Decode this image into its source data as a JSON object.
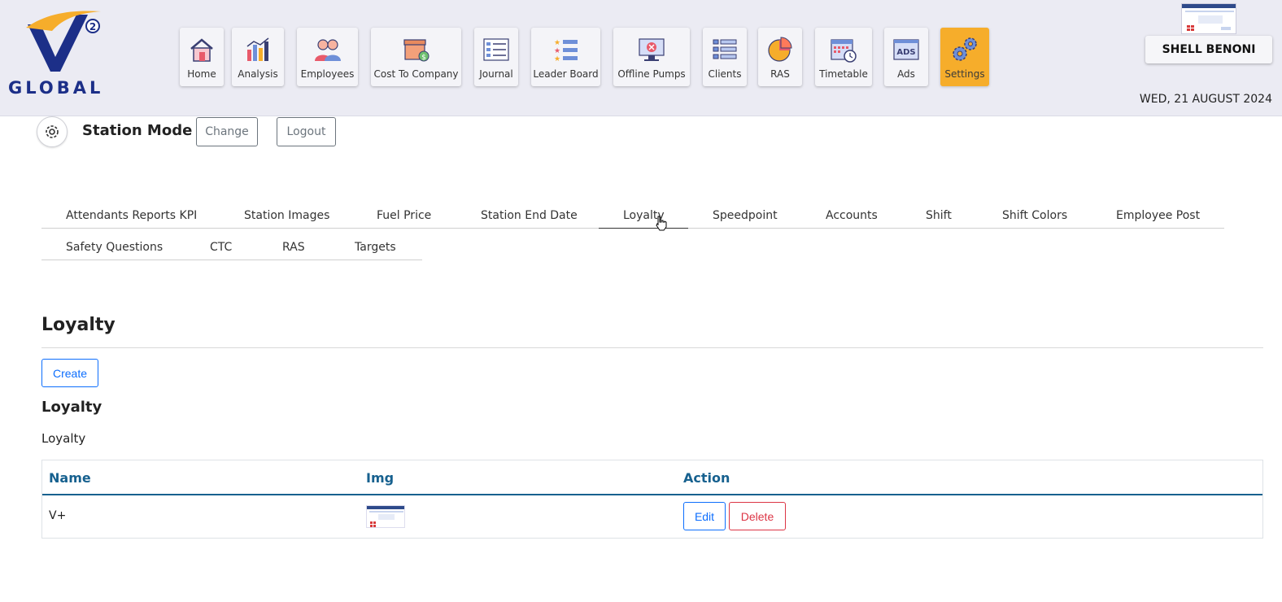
{
  "brand": {
    "logo_text": "GLOBAL",
    "logo_superscript": "2"
  },
  "nav": {
    "items": [
      {
        "label": "Home",
        "icon": "home-icon"
      },
      {
        "label": "Analysis",
        "icon": "bar-chart-icon"
      },
      {
        "label": "Employees",
        "icon": "people-icon"
      },
      {
        "label": "Cost To Company",
        "icon": "box-dollar-icon"
      },
      {
        "label": "Journal",
        "icon": "list-icon"
      },
      {
        "label": "Leader Board",
        "icon": "star-list-icon"
      },
      {
        "label": "Offline Pumps",
        "icon": "monitor-error-icon"
      },
      {
        "label": "Clients",
        "icon": "numbered-list-icon"
      },
      {
        "label": "RAS",
        "icon": "pie-chart-icon"
      },
      {
        "label": "Timetable",
        "icon": "calendar-clock-icon"
      },
      {
        "label": "Ads",
        "icon": "ads-icon"
      },
      {
        "label": "Settings",
        "icon": "gears-icon",
        "active": true
      }
    ]
  },
  "header": {
    "store_name": "SHELL BENONI",
    "date": "WED, 21 AUGUST 2024"
  },
  "station": {
    "title": "Station Mode",
    "change_label": "Change",
    "logout_label": "Logout"
  },
  "tabs": {
    "row1": [
      "Attendants Reports KPI",
      "Station Images",
      "Fuel Price",
      "Station End Date",
      "Loyalty",
      "Speedpoint",
      "Accounts",
      "Shift",
      "Shift Colors",
      "Employee Post"
    ],
    "row2": [
      "Safety Questions",
      "CTC",
      "RAS",
      "Targets"
    ],
    "active": "Loyalty"
  },
  "content": {
    "section_title": "Loyalty",
    "create_label": "Create",
    "sub_title": "Loyalty",
    "sub_text": "Loyalty",
    "table": {
      "headers": [
        "Name",
        "Img",
        "Action"
      ],
      "rows": [
        {
          "name": "V+",
          "edit_label": "Edit",
          "delete_label": "Delete"
        }
      ]
    }
  },
  "colors": {
    "header_bg": "#ebebf3",
    "active_nav": "#f6ad2b",
    "primary": "#0d6efd",
    "danger": "#dc3545",
    "table_header": "#17618f",
    "brand_navy": "#1c2f88"
  }
}
